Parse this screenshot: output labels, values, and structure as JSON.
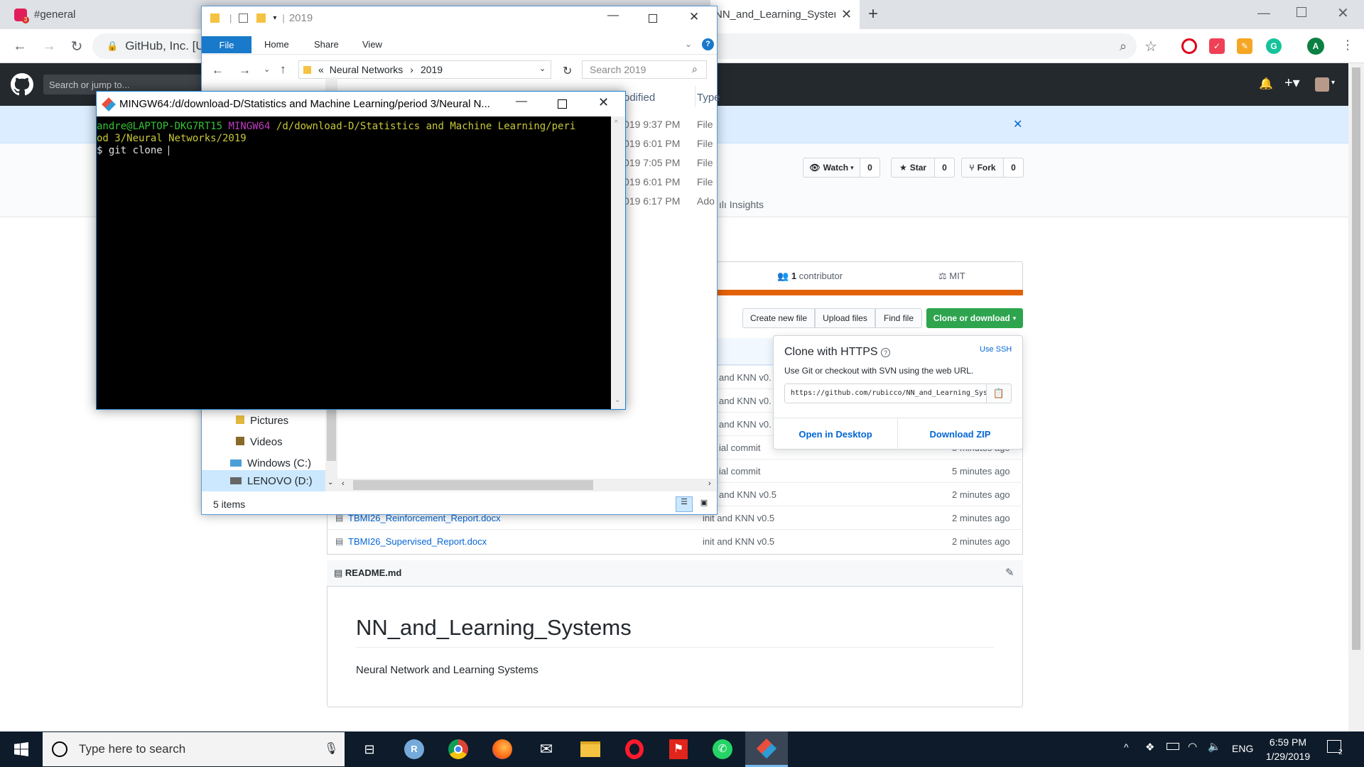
{
  "browser": {
    "tabs": [
      {
        "title": "#general",
        "icon": "slack-icon"
      },
      {
        "title": "NN_and_Learning_Systems",
        "icon": "github-icon"
      }
    ],
    "address_site": "GitHub, Inc. [U",
    "new_tab_symbol": "+",
    "profile_initial": "A"
  },
  "github": {
    "search_placeholder": "Search or jump to...",
    "watch_label": "Watch",
    "watch_count": "0",
    "star_label": "Star",
    "star_count": "0",
    "fork_label": "Fork",
    "fork_count": "0",
    "insights_label": "Insights",
    "contributors": "1",
    "contributors_label": "contributor",
    "license": "MIT",
    "buttons": {
      "create_file": "Create new file",
      "upload_files": "Upload files",
      "find_file": "Find file",
      "clone": "Clone or download"
    },
    "clone_popup": {
      "title": "Clone with HTTPS",
      "use_ssh": "Use SSH",
      "description": "Use Git or checkout with SVN using the web URL.",
      "url": "https://github.com/rubicco/NN_and_Learning_Systems.git",
      "open_desktop": "Open in Desktop",
      "download_zip": "Download ZIP"
    },
    "files": [
      {
        "name": "",
        "message": "and KNN v0.",
        "time": ""
      },
      {
        "name": "",
        "message": "and KNN v0.",
        "time": ""
      },
      {
        "name": "",
        "message": "and KNN v0.",
        "time": ""
      },
      {
        "name": "",
        "message": "ial commit",
        "time": "5 minutes ago"
      },
      {
        "name": "",
        "message": "ial commit",
        "time": "5 minutes ago"
      },
      {
        "name": "",
        "message": "and KNN v0.5",
        "time": "2 minutes ago"
      },
      {
        "name": "TBMI26_Reinforcement_Report.docx",
        "message": "init and KNN v0.5",
        "time": "2 minutes ago"
      },
      {
        "name": "TBMI26_Supervised_Report.docx",
        "message": "init and KNN v0.5",
        "time": "2 minutes ago"
      }
    ],
    "readme_label": "README.md",
    "readme_title": "NN_and_Learning_Systems",
    "readme_text": "Neural Network and Learning Systems"
  },
  "explorer": {
    "title": "2019",
    "ribbon_tabs": [
      "File",
      "Home",
      "Share",
      "View"
    ],
    "path": [
      "Neural Networks",
      "2019"
    ],
    "path_prefix": "«",
    "search_placeholder": "Search 2019",
    "col_modified": "odified",
    "col_type": "Type",
    "rows": [
      {
        "date": "019 9:37 PM",
        "type": "File"
      },
      {
        "date": "019 6:01 PM",
        "type": "File"
      },
      {
        "date": "019 7:05 PM",
        "type": "File"
      },
      {
        "date": "019 6:01 PM",
        "type": "File"
      },
      {
        "date": "019 6:17 PM",
        "type": "Ado"
      }
    ],
    "nav_items": [
      "Pictures",
      "Videos",
      "Windows (C:)",
      "LENOVO (D:)"
    ],
    "status": "5 items"
  },
  "terminal": {
    "title": "MINGW64:/d/download-D/Statistics and Machine Learning/period 3/Neural N...",
    "user": "andre@LAPTOP-DKG7RT15",
    "env": "MINGW64",
    "path_line1": "/d/download-D/Statistics and Machine Learning/peri",
    "path_line2": "od 3/Neural Networks/2019",
    "command": "$ git clone "
  },
  "taskbar": {
    "search_placeholder": "Type here to search",
    "language": "ENG",
    "time": "6:59 PM",
    "date": "1/29/2019",
    "notification_count": "2"
  }
}
